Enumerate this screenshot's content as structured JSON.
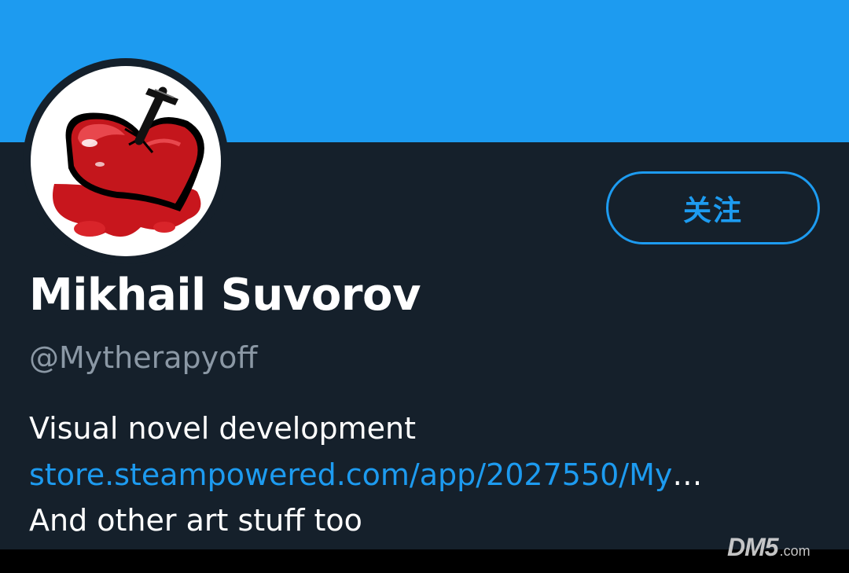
{
  "banner": {
    "color": "#1d9bf0"
  },
  "avatar": {
    "icon": "nailed-heart-icon"
  },
  "follow_button": {
    "label": "关注"
  },
  "profile": {
    "display_name": "Mikhail Suvorov",
    "handle": "@Mytherapyoff",
    "bio": {
      "line1": "Visual novel development",
      "link": "store.steampowered.com/app/2027550/My",
      "link_ellipsis": "…",
      "line3": "And other art stuff too"
    }
  },
  "watermark": {
    "main": "DM5",
    "suffix": ".com"
  },
  "colors": {
    "accent": "#1d9bf0",
    "background": "#15202b",
    "muted_text": "#8b98a5"
  }
}
